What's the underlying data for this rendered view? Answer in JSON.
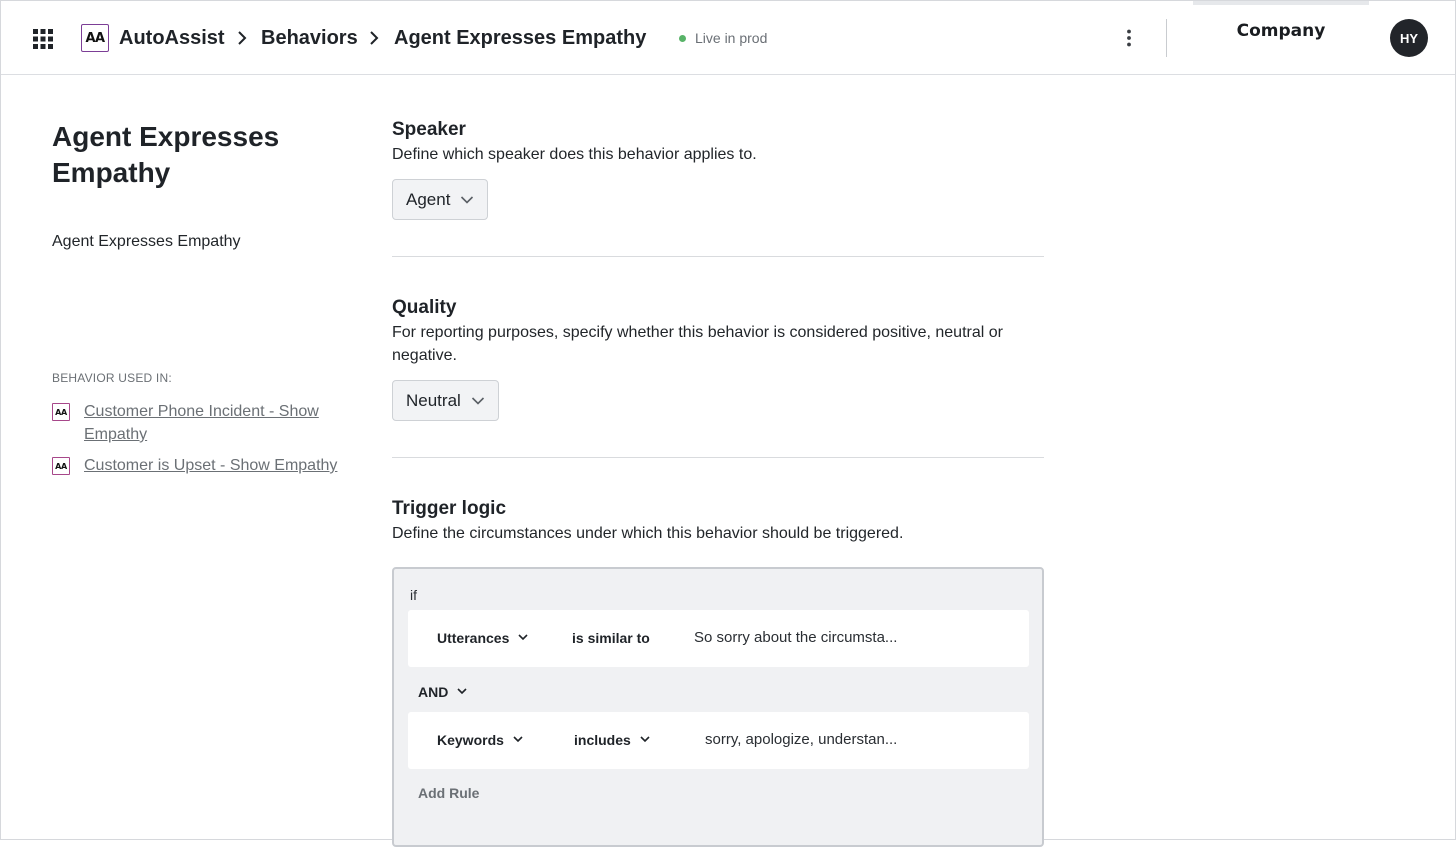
{
  "header": {
    "app_logo_text": "AA",
    "breadcrumbs": [
      "AutoAssist",
      "Behaviors",
      "Agent Expresses Empathy"
    ],
    "status": "Live in prod",
    "status_color": "#58b368",
    "company": "Company",
    "avatar_initials": "HY",
    "icons": [
      "app-grid-icon",
      "chevron-right-icon",
      "kebab-menu-icon"
    ]
  },
  "sidebar": {
    "title": "Agent Expresses Empathy",
    "description": "Agent Expresses Empathy",
    "used_in_label": "BEHAVIOR USED IN:",
    "used_in": [
      {
        "logo": "AA",
        "label": "Customer Phone Incident - Show Empathy"
      },
      {
        "logo": "AA",
        "label": "Customer is Upset - Show Empathy"
      }
    ]
  },
  "speaker": {
    "title": "Speaker",
    "description": "Define which speaker does this behavior applies to.",
    "value": "Agent"
  },
  "quality": {
    "title": "Quality",
    "description": "For reporting purposes, specify whether this behavior is considered positive, neutral or negative.",
    "value": "Neutral"
  },
  "trigger": {
    "title": "Trigger logic",
    "description": "Define the circumstances under which this behavior should be triggered.",
    "if_label": "if",
    "rules": [
      {
        "field": "Utterances",
        "operator": "is similar to",
        "value": "So sorry about the circumsta..."
      },
      {
        "field": "Keywords",
        "operator": "includes",
        "value": "sorry, apologize, understan..."
      }
    ],
    "join_operator": "AND",
    "add_rule_label": "Add Rule"
  }
}
